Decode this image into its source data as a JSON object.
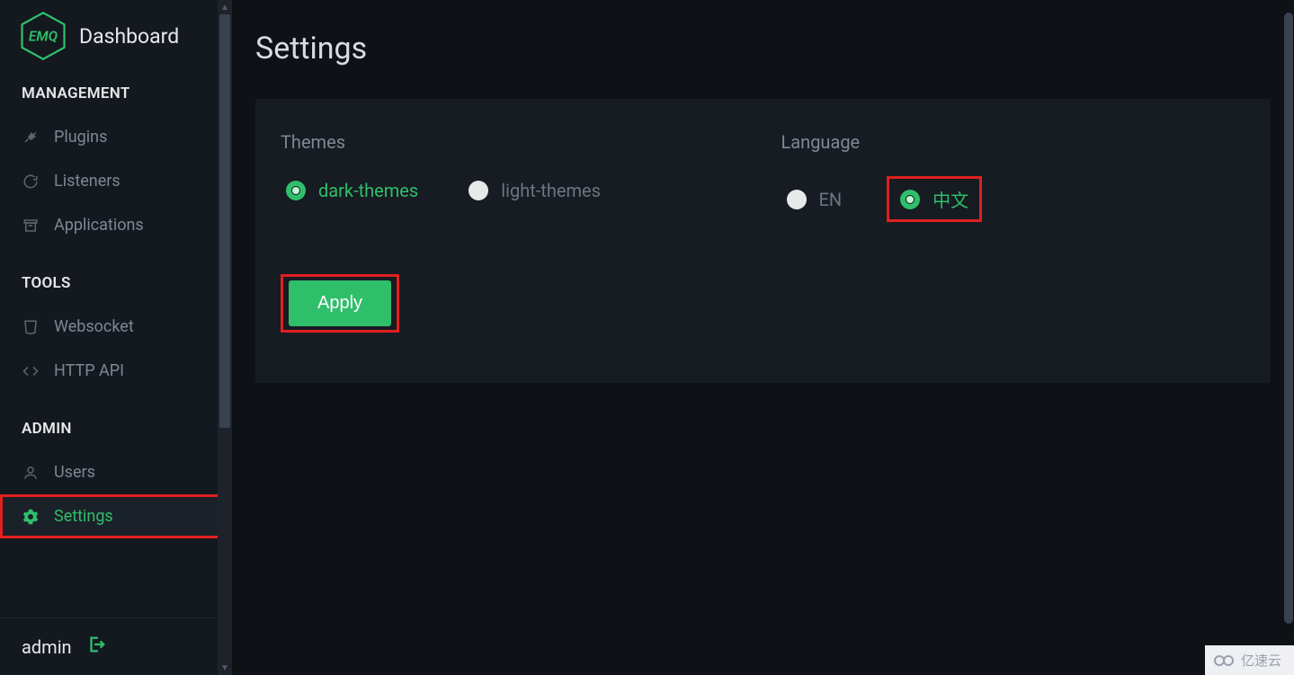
{
  "brand": {
    "logo_text": "EMQ",
    "title": "Dashboard"
  },
  "sidebar": {
    "sections": [
      {
        "header": "MANAGEMENT",
        "items": [
          {
            "label": "Plugins",
            "icon": "plug-icon"
          },
          {
            "label": "Listeners",
            "icon": "refresh-icon"
          },
          {
            "label": "Applications",
            "icon": "archive-icon"
          }
        ]
      },
      {
        "header": "TOOLS",
        "items": [
          {
            "label": "Websocket",
            "icon": "html5-icon"
          },
          {
            "label": "HTTP API",
            "icon": "code-icon"
          }
        ]
      },
      {
        "header": "ADMIN",
        "items": [
          {
            "label": "Users",
            "icon": "user-icon"
          },
          {
            "label": "Settings",
            "icon": "gear-icon",
            "active": true
          }
        ]
      }
    ]
  },
  "user": {
    "name": "admin"
  },
  "page": {
    "title": "Settings",
    "themes_label": "Themes",
    "theme_options": [
      {
        "value": "dark-themes",
        "selected": true
      },
      {
        "value": "light-themes",
        "selected": false
      }
    ],
    "language_label": "Language",
    "language_options": [
      {
        "value": "EN",
        "selected": false
      },
      {
        "value": "中文",
        "selected": true,
        "highlight": true
      }
    ],
    "apply_label": "Apply"
  },
  "watermark": "亿速云"
}
